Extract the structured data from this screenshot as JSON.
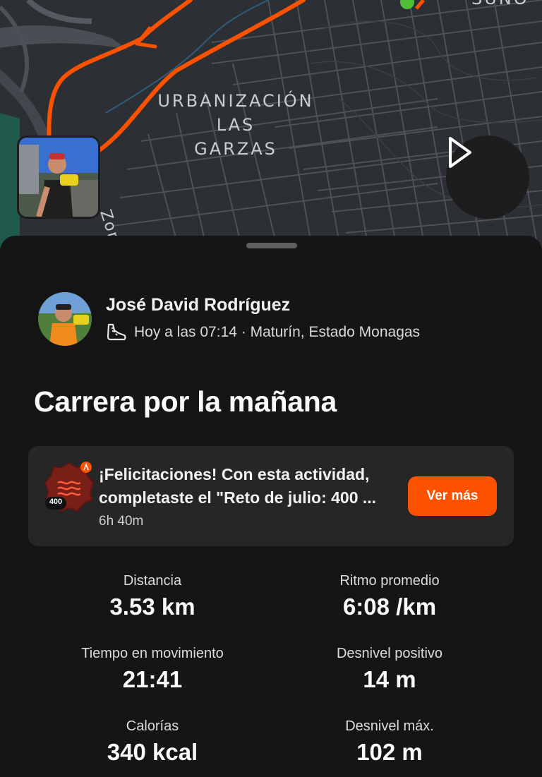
{
  "map": {
    "area_label": [
      "URBANIZACIÓN",
      "LAS",
      "GARZAS"
    ],
    "road_fragment": "Zon",
    "corner_fragment": "SUNO",
    "route_color": "#fc5200",
    "photo_icon": "activity-photo",
    "play_icon": "play-icon"
  },
  "athlete": {
    "name": "José David Rodríguez",
    "activity_icon": "running-shoe-icon",
    "meta": "Hoy a las 07:14 · Maturín, Estado Monagas"
  },
  "activity": {
    "title": "Carrera por la mañana"
  },
  "banner": {
    "badge_text": "400",
    "line1": "¡Felicitaciones! Con esta actividad,",
    "line2": "completaste el \"Reto de julio: 400 ...",
    "subtitle": "6h 40m",
    "button": "Ver más",
    "accent": "#fc5200"
  },
  "stats": [
    {
      "label": "Distancia",
      "value": "3.53 km"
    },
    {
      "label": "Ritmo promedio",
      "value": "6:08 /km"
    },
    {
      "label": "Tiempo en movimiento",
      "value": "21:41"
    },
    {
      "label": "Desnivel positivo",
      "value": "14 m"
    },
    {
      "label": "Calorías",
      "value": "340 kcal"
    },
    {
      "label": "Desnivel máx.",
      "value": "102 m"
    }
  ]
}
